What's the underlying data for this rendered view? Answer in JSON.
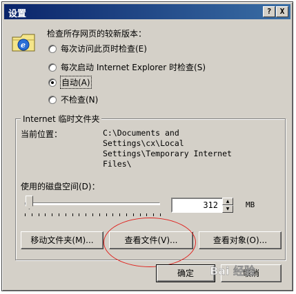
{
  "window": {
    "title": "设置",
    "help_label": "?",
    "close_label": "X"
  },
  "check_section": {
    "heading": "检查所存网页的较新版本：",
    "options": [
      {
        "label": "每次访问此页时检查(E)",
        "checked": false
      },
      {
        "label": "每次启动 Internet Explorer 时检查(S)",
        "checked": false
      },
      {
        "label": "自动(A)",
        "checked": true
      },
      {
        "label": "不检查(N)",
        "checked": false
      }
    ]
  },
  "temp_files": {
    "group_title": "Internet 临时文件夹",
    "current_location_label": "当前位置：",
    "current_location_value": "C:\\Documents and\nSettings\\cx\\Local\nSettings\\Temporary Internet\nFiles\\",
    "disk_space_label": "使用的磁盘空间(D)：",
    "disk_space_value": "312",
    "disk_space_unit": "MB",
    "slider_level_fraction": 0.02
  },
  "buttons": {
    "move_folder": "移动文件夹(M)...",
    "view_files": "查看文件(V)...",
    "view_objects": "查看对象(O)...",
    "ok": "确定",
    "cancel": "取消"
  },
  "watermark_text": "Bai 经验",
  "colors": {
    "titlebar_start": "#0a246a",
    "titlebar_end": "#3a6ea5",
    "face": "#d4d0c8",
    "annotation": "#e0201c"
  },
  "icons": {
    "title_help": "question-mark-icon",
    "title_close": "close-icon",
    "section_icon": "ie-globe-folder-icon"
  }
}
